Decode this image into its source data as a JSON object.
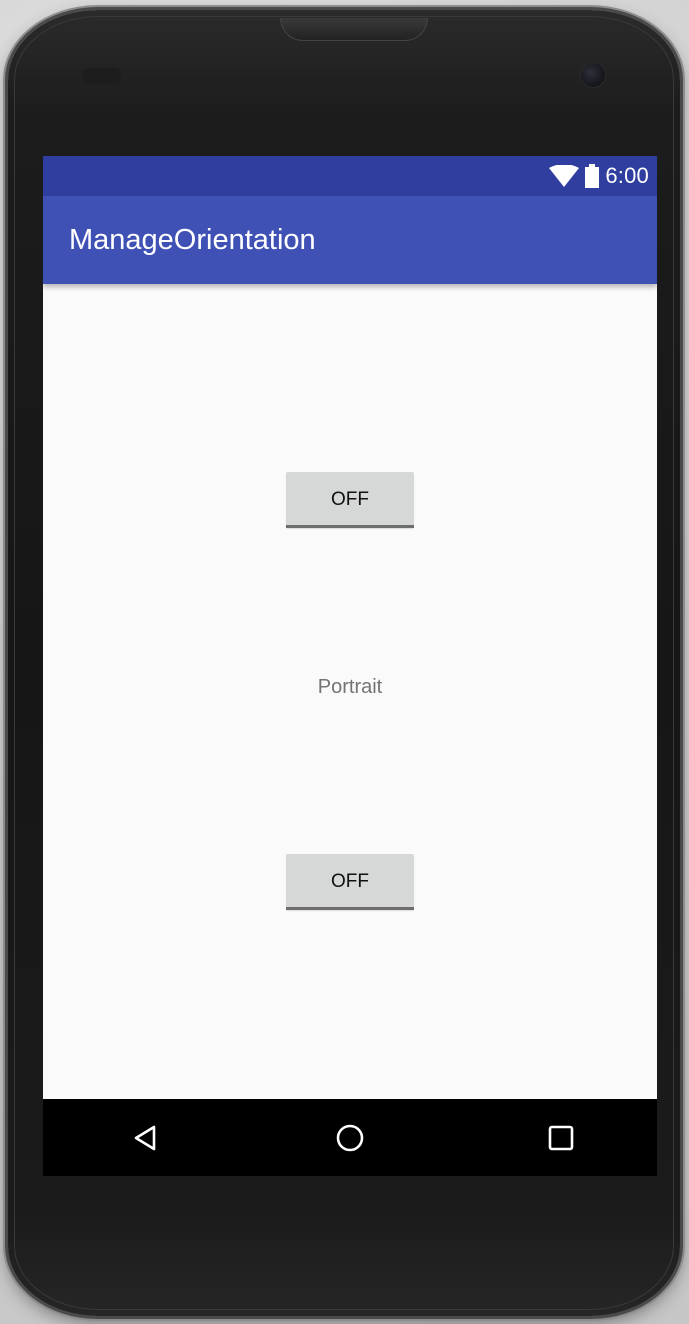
{
  "status_bar": {
    "time": "6:00",
    "icons": [
      "wifi-icon",
      "battery-icon"
    ]
  },
  "app_bar": {
    "title": "ManageOrientation"
  },
  "content": {
    "top_toggle_label": "OFF",
    "orientation_label": "Portrait",
    "bottom_toggle_label": "OFF"
  },
  "nav_bar": {
    "icons": [
      "back-icon",
      "home-icon",
      "recents-icon"
    ]
  },
  "colors": {
    "status_bar": "#303f9f",
    "app_bar": "#3f51b5",
    "background": "#fafafa",
    "button": "#d6d7d7",
    "nav_bar": "#000000"
  }
}
